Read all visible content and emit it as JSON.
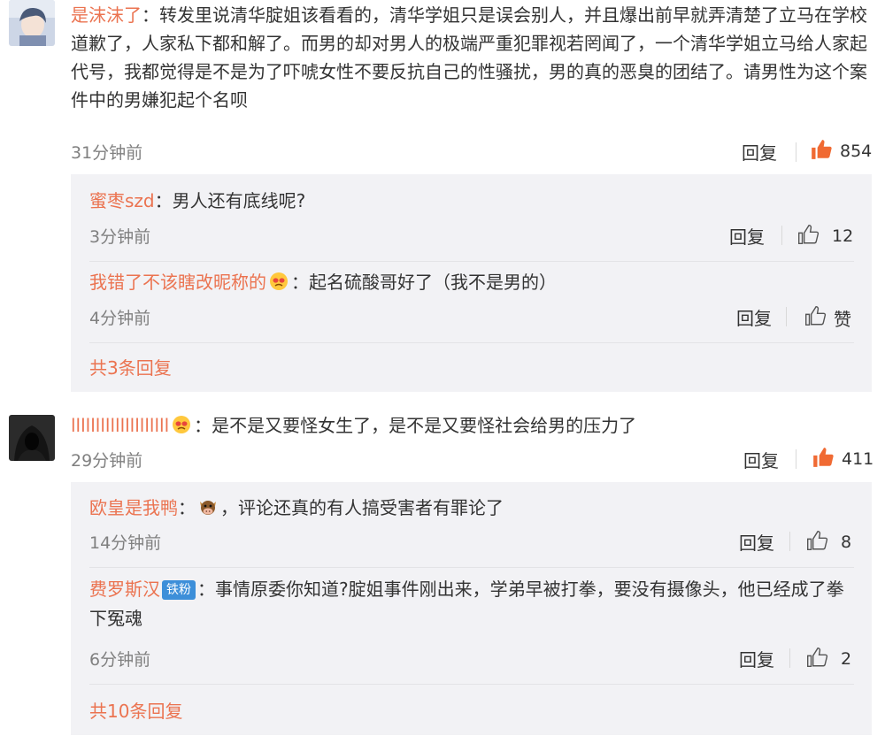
{
  "comments": [
    {
      "username": "是沫沫了",
      "separator": "：",
      "text": "转发里说清华腚姐该看看的，清华学姐只是误会别人，并且爆出前早就弄清楚了立马在学校道歉了，人家私下都和解了。而男的却对男人的极端严重犯罪视若罔闻了，一个清华学姐立马给人家起代号，我都觉得是不是为了吓唬女性不要反抗自己的性骚扰，男的真的恶臭的团结了。请男性为这个案件中的男嫌犯起个名呗",
      "time": "31分钟前",
      "reply_label": "回复",
      "like_count": "854",
      "replies": [
        {
          "username": "蜜枣szd",
          "separator": "：",
          "text": "男人还有底线呢?",
          "time": "3分钟前",
          "reply_label": "回复",
          "like_count": "12"
        },
        {
          "username": "我错了不该瞎改昵称的",
          "separator": "：",
          "text": "起名硫酸哥好了（我不是男的）",
          "time": "4分钟前",
          "reply_label": "回复",
          "like_count": "赞"
        }
      ],
      "more_replies": "共3条回复"
    },
    {
      "username": "llllllllllllllllllll",
      "separator": "：",
      "text": "是不是又要怪女生了，是不是又要怪社会给男的压力了",
      "time": "29分钟前",
      "reply_label": "回复",
      "like_count": "411",
      "replies": [
        {
          "username": "欧皇是我鸭",
          "separator": "：",
          "text": "，评论还真的有人搞受害者有罪论了",
          "time": "14分钟前",
          "reply_label": "回复",
          "like_count": "8"
        },
        {
          "username": "费罗斯汉",
          "badge": "铁粉",
          "separator": "：",
          "text": "事情原委你知道?腚姐事件刚出来，学弟早被打拳，要没有摄像头，他已经成了拳下冤魂",
          "time": "6分钟前",
          "reply_label": "回复",
          "like_count": "2"
        }
      ],
      "more_replies": "共10条回复"
    }
  ],
  "colors": {
    "username": "#eb7350",
    "liked": "#f06a33",
    "panel": "#f2f2f5"
  },
  "icons": {
    "liked": "thumbs-up-filled-icon",
    "like": "thumbs-up-outline-icon",
    "emoji_face": "crying-face-emoji-icon",
    "emoji_cow": "cow-emoji-icon"
  }
}
